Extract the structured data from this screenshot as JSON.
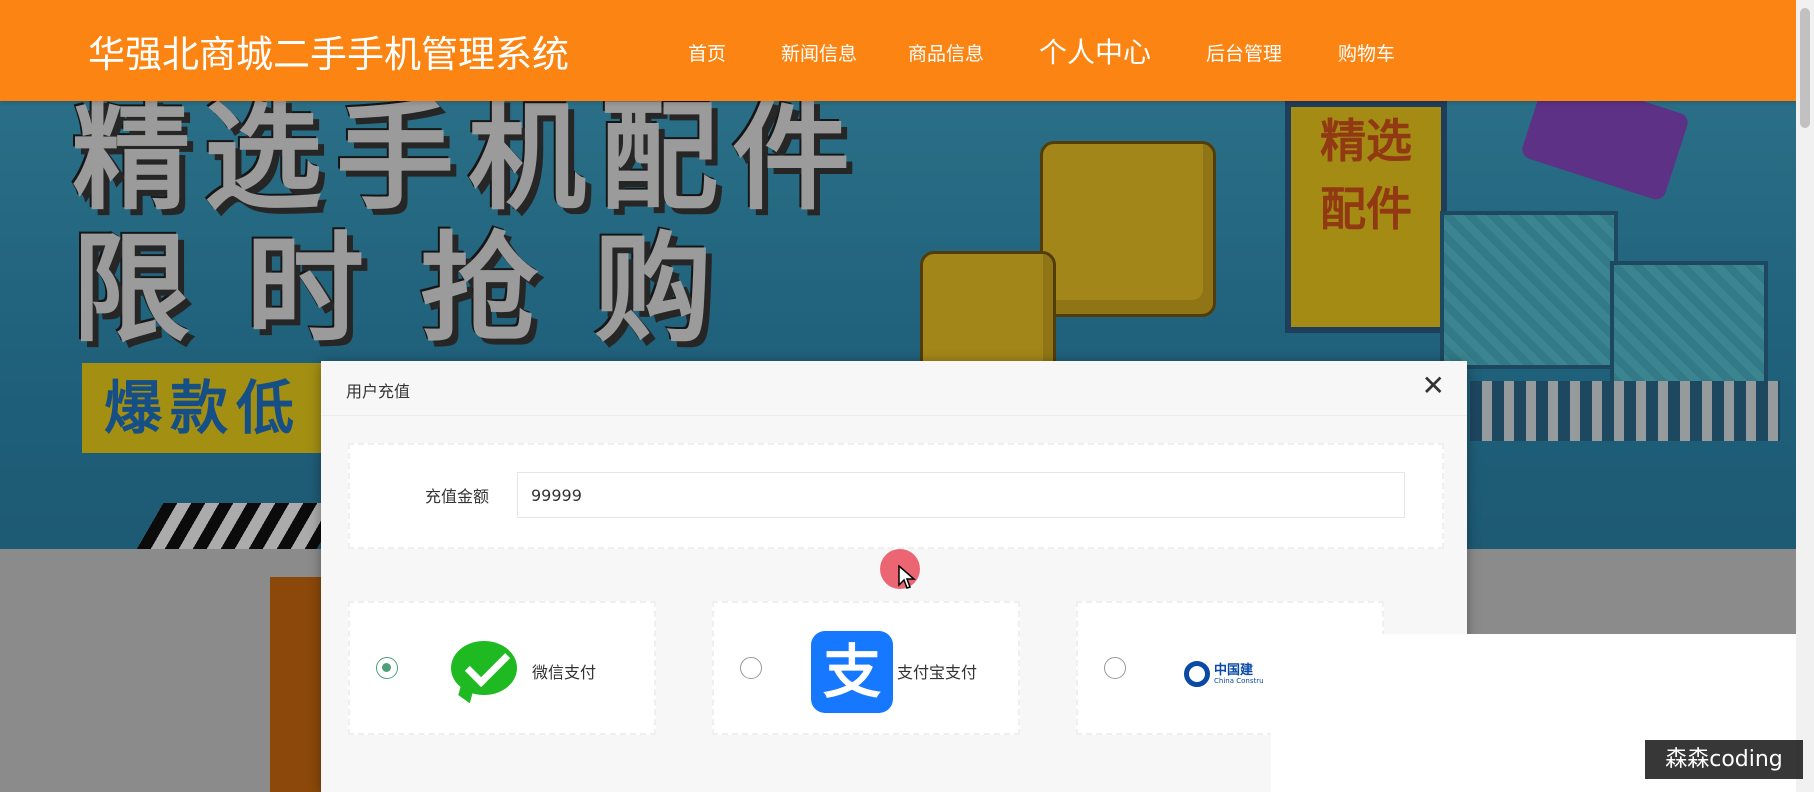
{
  "site": {
    "title": "华强北商城二手手机管理系统"
  },
  "nav": {
    "items": [
      {
        "label": "首页"
      },
      {
        "label": "新闻信息"
      },
      {
        "label": "商品信息"
      },
      {
        "label": "个人中心"
      },
      {
        "label": "后台管理"
      },
      {
        "label": "购物车"
      }
    ],
    "active": "个人中心"
  },
  "banner": {
    "line1": "精选手机配件",
    "line2": "限时抢购",
    "tag": "爆款低",
    "panel_text": [
      "精选",
      "配件"
    ]
  },
  "dialog": {
    "title": "用户充值",
    "close_icon": "close-icon",
    "amount": {
      "label": "充值金额",
      "value": "99999"
    },
    "payment_methods": [
      {
        "label": "微信支付",
        "icon": "wechat-icon",
        "selected": true
      },
      {
        "label": "支付宝支付",
        "icon": "alipay-icon",
        "selected": false
      },
      {
        "label": "中国建",
        "sub": "China Constru",
        "icon": "ccb-icon",
        "selected": false
      }
    ]
  },
  "watermark": "森森coding",
  "colors": {
    "nav_bg": "#fb8412",
    "radio_checked": "#4e9e7a",
    "cursor_highlight": "#e94c5a"
  }
}
